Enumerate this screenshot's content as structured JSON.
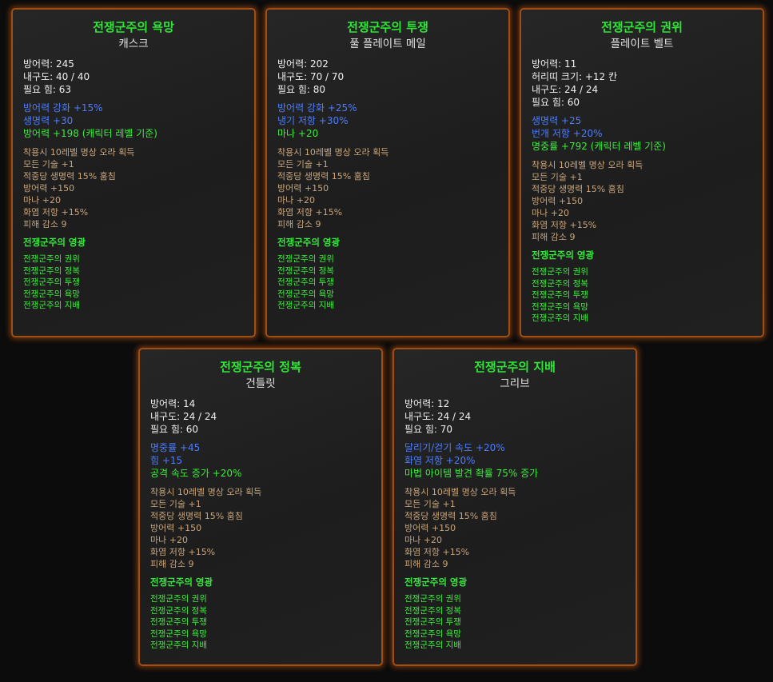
{
  "colors": {
    "background": "#0c0c0c",
    "border": "#a24d12",
    "set_green": "#2fe637",
    "magic_blue": "#4c7dff",
    "set_bonus_tan": "#c9a57a"
  },
  "cards": [
    {
      "title": "전쟁군주의 욕망",
      "subtitle": "캐스크",
      "base": [
        "방어력: 245",
        "내구도: 40 / 40",
        "필요 힘: 63"
      ],
      "magic": [
        {
          "text": "방어력 강화 +15%",
          "color": "blue"
        },
        {
          "text": "생명력 +30",
          "color": "blue"
        },
        {
          "text": "방어력 +198 (캐릭터 레벨 기준)",
          "color": "green"
        }
      ],
      "set_bonus": [
        "착용시 10레벨 명상 오라 획득",
        "모든 기술 +1",
        "적중당 생명력 15% 훔침",
        "방어력 +150",
        "마나 +20",
        "화염 저항 +15%",
        "피해 감소 9"
      ],
      "set_title": "전쟁군주의 영광",
      "set_items": [
        "전쟁군주의 권위",
        "전쟁군주의 정복",
        "전쟁군주의 투쟁",
        "전쟁군주의 욕망",
        "전쟁군주의 지배"
      ]
    },
    {
      "title": "전쟁군주의 투쟁",
      "subtitle": "풀 플레이트 메일",
      "base": [
        "방어력: 202",
        "내구도: 70 / 70",
        "필요 힘: 80"
      ],
      "magic": [
        {
          "text": "방어력 강화 +25%",
          "color": "blue"
        },
        {
          "text": "냉기 저항 +30%",
          "color": "blue"
        },
        {
          "text": "마나 +20",
          "color": "green"
        }
      ],
      "set_bonus": [
        "착용시 10레벨 명상 오라 획득",
        "모든 기술 +1",
        "적중당 생명력 15% 훔침",
        "방어력 +150",
        "마나 +20",
        "화염 저항 +15%",
        "피해 감소 9"
      ],
      "set_title": "전쟁군주의 영광",
      "set_items": [
        "전쟁군주의 권위",
        "전쟁군주의 정복",
        "전쟁군주의 투쟁",
        "전쟁군주의 욕망",
        "전쟁군주의 지배"
      ]
    },
    {
      "title": "전쟁군주의 권위",
      "subtitle": "플레이트 벨트",
      "base": [
        "방어력: 11",
        "허리띠 크기: +12 칸",
        "내구도: 24 / 24",
        "필요 힘: 60"
      ],
      "magic": [
        {
          "text": "생명력 +25",
          "color": "blue"
        },
        {
          "text": "번개 저항 +20%",
          "color": "blue"
        },
        {
          "text": "명중률 +792 (캐릭터 레벨 기준)",
          "color": "green"
        }
      ],
      "set_bonus": [
        "착용시 10레벨 명상 오라 획득",
        "모든 기술 +1",
        "적중당 생명력 15% 훔침",
        "방어력 +150",
        "마나 +20",
        "화염 저항 +15%",
        "피해 감소 9"
      ],
      "set_title": "전쟁군주의 영광",
      "set_items": [
        "전쟁군주의 권위",
        "전쟁군주의 정복",
        "전쟁군주의 투쟁",
        "전쟁군주의 욕망",
        "전쟁군주의 지배"
      ]
    },
    {
      "title": "전쟁군주의 정복",
      "subtitle": "건틀릿",
      "base": [
        "방어력: 14",
        "내구도: 24 / 24",
        "필요 힘: 60"
      ],
      "magic": [
        {
          "text": "명중률 +45",
          "color": "blue"
        },
        {
          "text": "힘 +15",
          "color": "blue"
        },
        {
          "text": "공격 속도 증가 +20%",
          "color": "green"
        }
      ],
      "set_bonus": [
        "착용시 10레벨 명상 오라 획득",
        "모든 기술 +1",
        "적중당 생명력 15% 훔침",
        "방어력 +150",
        "마나 +20",
        "화염 저항 +15%",
        "피해 감소 9"
      ],
      "set_title": "전쟁군주의 영광",
      "set_items": [
        "전쟁군주의 권위",
        "전쟁군주의 정복",
        "전쟁군주의 투쟁",
        "전쟁군주의 욕망",
        "전쟁군주의 지배"
      ]
    },
    {
      "title": "전쟁군주의 지배",
      "subtitle": "그리브",
      "base": [
        "방어력: 12",
        "내구도: 24 / 24",
        "필요 힘: 70"
      ],
      "magic": [
        {
          "text": "달리기/걷기 속도 +20%",
          "color": "blue"
        },
        {
          "text": "화염 저항 +20%",
          "color": "blue"
        },
        {
          "text": "마법 아이템 발견 확률 75% 증가",
          "color": "green"
        }
      ],
      "set_bonus": [
        "착용시 10레벨 명상 오라 획득",
        "모든 기술 +1",
        "적중당 생명력 15% 훔침",
        "방어력 +150",
        "마나 +20",
        "화염 저항 +15%",
        "피해 감소 9"
      ],
      "set_title": "전쟁군주의 영광",
      "set_items": [
        "전쟁군주의 권위",
        "전쟁군주의 정복",
        "전쟁군주의 투쟁",
        "전쟁군주의 욕망",
        "전쟁군주의 지배"
      ]
    }
  ]
}
